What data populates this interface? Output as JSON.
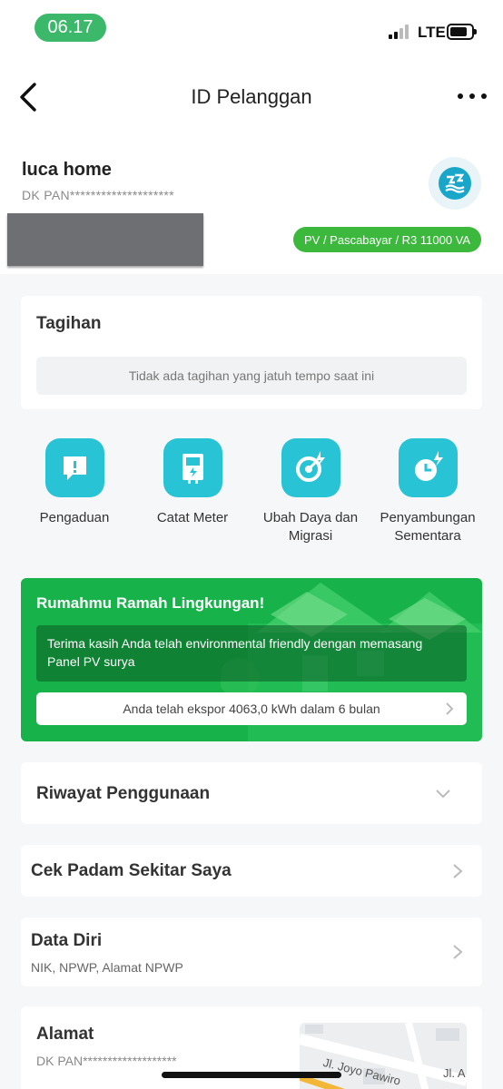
{
  "status_bar": {
    "time": "06.17",
    "network": "LTE"
  },
  "header": {
    "title": "ID Pelanggan"
  },
  "profile": {
    "name": "luca home",
    "customer_id": "DK PAN********************",
    "tariff": "PV / Pascabayar / R3 11000 VA"
  },
  "bill": {
    "title": "Tagihan",
    "empty_message": "Tidak ada tagihan yang jatuh tempo saat ini"
  },
  "services": [
    {
      "label": "Pengaduan",
      "icon": "complaint-icon"
    },
    {
      "label": "Catat Meter",
      "icon": "meter-icon"
    },
    {
      "label": "Ubah Daya dan Migrasi",
      "icon": "power-change-icon"
    },
    {
      "label": "Penyambungan Sementara",
      "icon": "temporary-connection-icon"
    }
  ],
  "eco": {
    "title": "Rumahmu Ramah Lingkungan!",
    "message": "Terima kasih Anda telah environmental friendly dengan memasang Panel PV surya",
    "export": "Anda telah ekspor 4063,0 kWh dalam 6 bulan"
  },
  "usage_history": {
    "title": "Riwayat Penggunaan"
  },
  "outage": {
    "title": "Cek Padam Sekitar Saya"
  },
  "personal_data": {
    "title": "Data Diri",
    "subtitle": "NIK, NPWP, Alamat NPWP"
  },
  "address": {
    "title": "Alamat",
    "customer_id": "DK PAN*******************",
    "map_label_1": "Jl. Joyo Pawiro",
    "map_label_2": "Jl. A"
  },
  "colors": {
    "primary_green": "#17b34a",
    "badge_green": "#3cb83d",
    "teal": "#29c3d6"
  }
}
